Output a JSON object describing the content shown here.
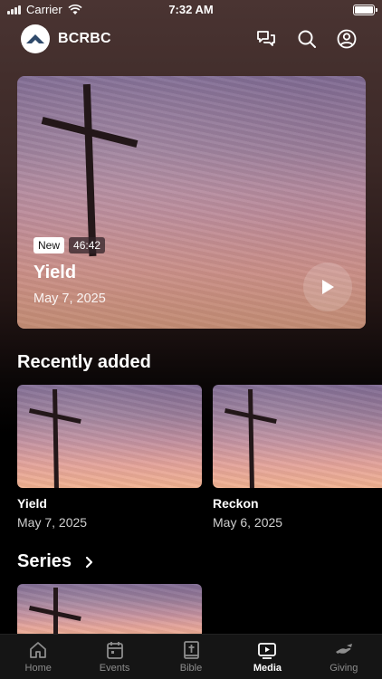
{
  "status": {
    "carrier": "Carrier",
    "time": "7:32 AM"
  },
  "header": {
    "brand": "BCRBC"
  },
  "hero": {
    "badge_new": "New",
    "duration": "46:42",
    "title": "Yield",
    "date": "May 7, 2025"
  },
  "recent": {
    "title": "Recently added",
    "items": [
      {
        "title": "Yield",
        "date": "May 7, 2025"
      },
      {
        "title": "Reckon",
        "date": "May 6, 2025"
      }
    ]
  },
  "series": {
    "title": "Series"
  },
  "tabs": [
    {
      "label": "Home",
      "icon": "home-icon"
    },
    {
      "label": "Events",
      "icon": "calendar-icon"
    },
    {
      "label": "Bible",
      "icon": "bible-icon"
    },
    {
      "label": "Media",
      "icon": "media-icon",
      "active": true
    },
    {
      "label": "Giving",
      "icon": "giving-icon"
    }
  ]
}
